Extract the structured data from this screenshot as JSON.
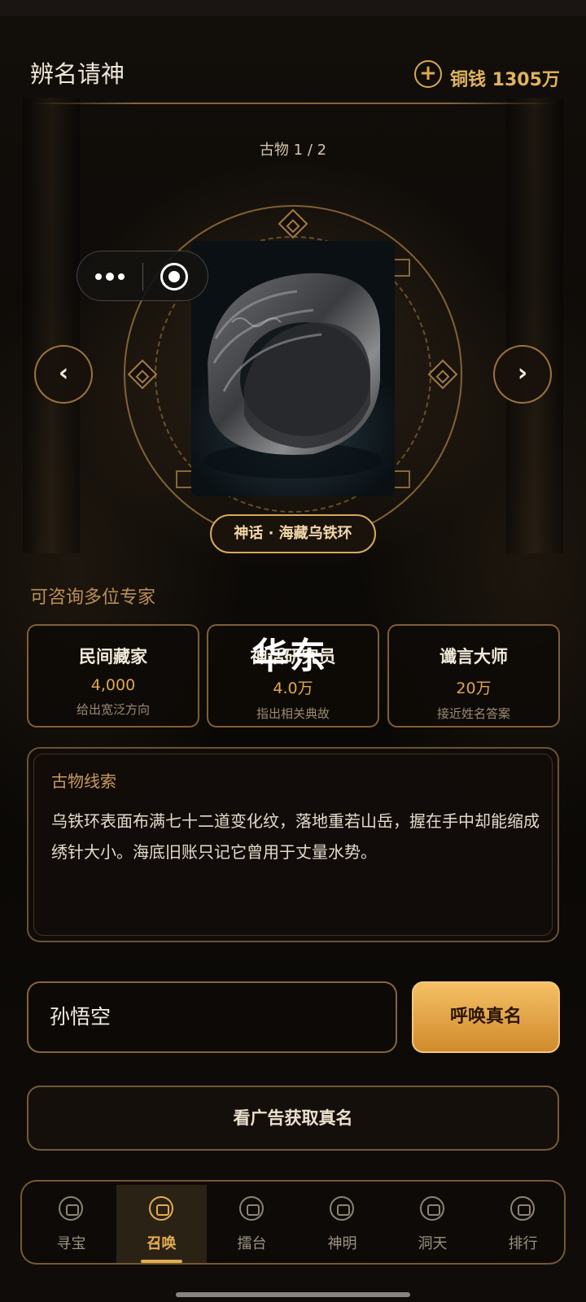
{
  "header": {
    "title": "辨名请神",
    "currency": "铜钱 1305万"
  },
  "artifact": {
    "counter": "古物 1 / 2",
    "name": "神话 · 海藏乌铁环"
  },
  "nav": {
    "prev": "‹",
    "next": "›"
  },
  "experts": {
    "title": "可咨询多位专家",
    "items": [
      {
        "name": "民间藏家",
        "price": "4,000",
        "desc": "给出宽泛方向"
      },
      {
        "name": "神话研究员",
        "price": "4.0万",
        "desc": "指出相关典故"
      },
      {
        "name": "谶言大师",
        "price": "20万",
        "desc": "接近姓名答案"
      }
    ],
    "overlay": "华东"
  },
  "clue": {
    "title": "古物线索",
    "text": "乌铁环表面布满七十二道变化纹，落地重若山岳，握在手中却能缩成绣针大小。海底旧账只记它曾用于丈量水势。"
  },
  "answer": {
    "value": "孙悟空",
    "submit": "呼唤真名"
  },
  "ad_button": "看广告获取真名",
  "tabs": [
    {
      "label": "寻宝",
      "icon": "treasure-icon",
      "active": false
    },
    {
      "label": "召唤",
      "icon": "summon-icon",
      "active": true
    },
    {
      "label": "擂台",
      "icon": "arena-icon",
      "active": false
    },
    {
      "label": "神明",
      "icon": "deity-icon",
      "active": false
    },
    {
      "label": "洞天",
      "icon": "cave-icon",
      "active": false
    },
    {
      "label": "排行",
      "icon": "ranking-icon",
      "active": false
    }
  ],
  "colors": {
    "accent": "#e2ad52",
    "background": "#0a0806",
    "border": "#be8c50"
  }
}
